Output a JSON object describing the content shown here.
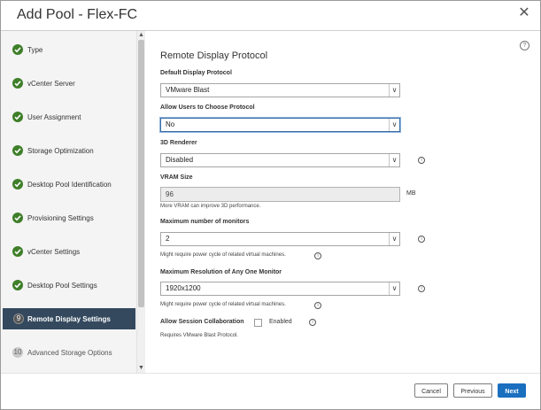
{
  "dialog": {
    "title": "Add Pool - Flex-FC"
  },
  "wizard": {
    "steps": [
      {
        "label": "Type",
        "state": "completed"
      },
      {
        "label": "vCenter Server",
        "state": "completed"
      },
      {
        "label": "User Assignment",
        "state": "completed"
      },
      {
        "label": "Storage Optimization",
        "state": "completed"
      },
      {
        "label": "Desktop Pool Identification",
        "state": "completed"
      },
      {
        "label": "Provisioning Settings",
        "state": "completed"
      },
      {
        "label": "vCenter Settings",
        "state": "completed"
      },
      {
        "label": "Desktop Pool Settings",
        "state": "completed"
      },
      {
        "number": "9",
        "label": "Remote Display Settings",
        "state": "active"
      },
      {
        "number": "10",
        "label": "Advanced Storage Options",
        "state": "pending"
      }
    ]
  },
  "section": {
    "title": "Remote Display Protocol",
    "fields": {
      "default_protocol": {
        "label": "Default Display Protocol",
        "value": "VMware Blast"
      },
      "allow_choose": {
        "label": "Allow Users to Choose Protocol",
        "value": "No"
      },
      "renderer": {
        "label": "3D Renderer",
        "value": "Disabled"
      },
      "vram": {
        "label": "VRAM Size",
        "value": "96",
        "unit": "MB",
        "hint": "More VRAM can improve 3D performance."
      },
      "max_monitors": {
        "label": "Maximum number of monitors",
        "value": "2",
        "hint": "Might require power cycle of related virtual machines."
      },
      "max_resolution": {
        "label": "Maximum Resolution of Any One Monitor",
        "value": "1920x1200",
        "hint": "Might require power cycle of related virtual machines."
      },
      "collaboration": {
        "label": "Allow Session Collaboration",
        "checkbox_label": "Enabled",
        "checked": false,
        "hint": "Requires VMware Blast Protocol."
      }
    }
  },
  "buttons": {
    "cancel": "Cancel",
    "previous": "Previous",
    "next": "Next"
  }
}
